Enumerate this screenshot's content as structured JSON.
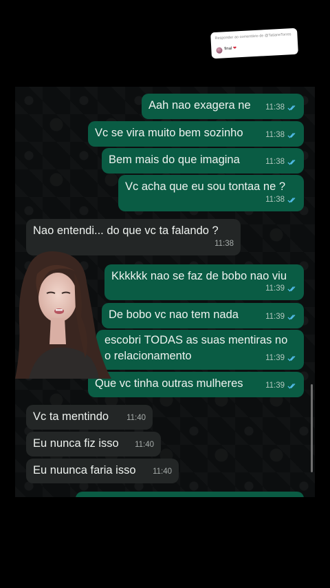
{
  "reply_sticker": {
    "title": "Responder ao comentário de @TatianeTorres",
    "comment": "final",
    "heart": "❤"
  },
  "messages": [
    {
      "text": "Aah nao exagera ne",
      "time": "11:38",
      "direction": "outgoing",
      "status": "read"
    },
    {
      "text": "Vc se vira muito bem sozinho",
      "time": "11:38",
      "direction": "outgoing",
      "status": "read"
    },
    {
      "text": "Bem mais do que imagina",
      "time": "11:38",
      "direction": "outgoing",
      "status": "read"
    },
    {
      "text": "Vc acha que eu sou tontaa ne ?",
      "time": "11:38",
      "direction": "outgoing",
      "status": "read"
    },
    {
      "text": "Nao entendi... do que vc ta falando ?",
      "time": "11:38",
      "direction": "incoming"
    },
    {
      "text": "Kkkkkk nao se faz de bobo nao viu",
      "time": "11:39",
      "direction": "outgoing",
      "status": "read"
    },
    {
      "text": "De bobo vc nao tem nada",
      "time": "11:39",
      "direction": "outgoing",
      "status": "read"
    },
    {
      "text": "escobri TODAS as suas mentiras no",
      "text2": "o relacionamento",
      "time": "11:39",
      "direction": "outgoing",
      "status": "read"
    },
    {
      "text": "Que vc tinha outras mulheres",
      "time": "11:39",
      "direction": "outgoing",
      "status": "read"
    },
    {
      "text": "Vc ta mentindo",
      "time": "11:40",
      "direction": "incoming"
    },
    {
      "text": "Eu nunca fiz isso",
      "time": "11:40",
      "direction": "incoming"
    },
    {
      "text": "Eu nuunca faria isso",
      "time": "11:40",
      "direction": "incoming"
    }
  ],
  "colors": {
    "outgoing_bubble": "#0a5c44",
    "incoming_bubble": "#232626",
    "read_ticks": "#53bdeb",
    "chat_background": "#0c0e0f"
  }
}
